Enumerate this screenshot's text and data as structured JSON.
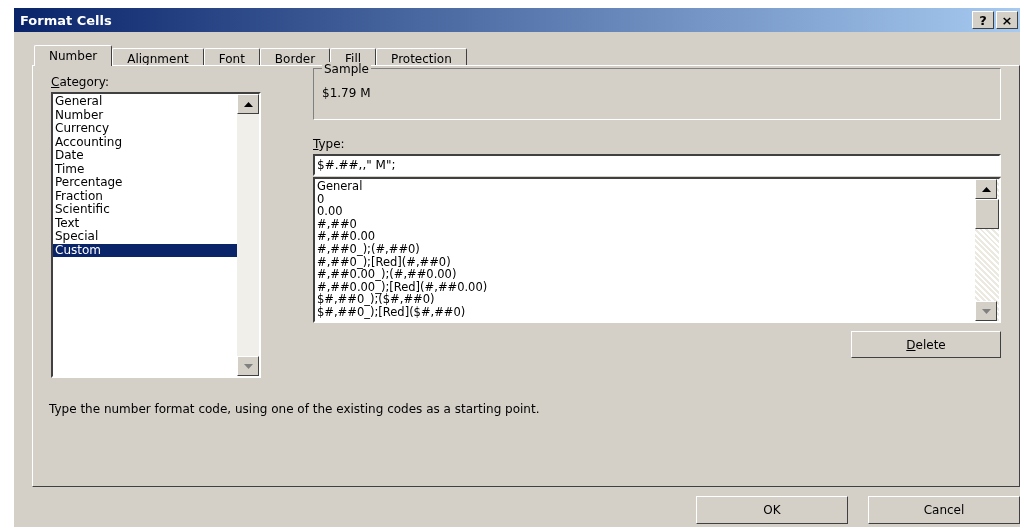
{
  "window": {
    "title": "Format Cells",
    "title_buttons": [
      "?",
      "×"
    ]
  },
  "tabs": [
    {
      "label": "Number",
      "selected": true
    },
    {
      "label": "Alignment",
      "selected": false
    },
    {
      "label": "Font",
      "selected": false
    },
    {
      "label": "Border",
      "selected": false
    },
    {
      "label": "Fill",
      "selected": false
    },
    {
      "label": "Protection",
      "selected": false
    }
  ],
  "category": {
    "label": "Category:",
    "items": [
      {
        "label": "General",
        "selected": false
      },
      {
        "label": "Number",
        "selected": false
      },
      {
        "label": "Currency",
        "selected": false
      },
      {
        "label": "Accounting",
        "selected": false
      },
      {
        "label": "Date",
        "selected": false
      },
      {
        "label": "Time",
        "selected": false
      },
      {
        "label": "Percentage",
        "selected": false
      },
      {
        "label": "Fraction",
        "selected": false
      },
      {
        "label": "Scientific",
        "selected": false
      },
      {
        "label": "Text",
        "selected": false
      },
      {
        "label": "Special",
        "selected": false
      },
      {
        "label": "Custom",
        "selected": true
      }
    ]
  },
  "sample": {
    "label": "Sample",
    "value": "$1.79 M"
  },
  "type": {
    "label": "Type:",
    "value": "$#.##,,\" M\";",
    "items": [
      "General",
      "0",
      "0.00",
      "#,##0",
      "#,##0.00",
      "#,##0_);(#,##0)",
      "#,##0_);[Red](#,##0)",
      "#,##0.00_);(#,##0.00)",
      "#,##0.00_);[Red](#,##0.00)",
      "$#,##0_);($#,##0)",
      "$#,##0_);[Red]($#,##0)"
    ]
  },
  "delete_button": "Delete",
  "description": "Type the number format code, using one of the existing codes as a starting point.",
  "buttons": [
    "OK",
    "Cancel"
  ]
}
